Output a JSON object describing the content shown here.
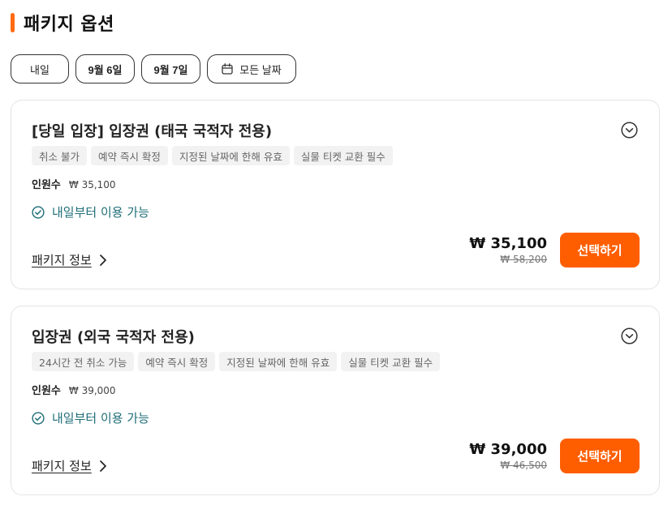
{
  "section": {
    "title": "패키지 옵션",
    "accent_color": "#ff6a13"
  },
  "dates": [
    {
      "label": "내일"
    },
    {
      "label": "9월 6일"
    },
    {
      "label": "9월 7일"
    },
    {
      "label": "모든 날짜",
      "icon": "calendar-icon"
    }
  ],
  "packages": [
    {
      "title": "[당일 입장] 입장권 (태국 국적자 전용)",
      "tags": [
        "취소 불가",
        "예약 즉시 확정",
        "지정된 날짜에 한해 유효",
        "실물 티켓 교환 필수"
      ],
      "pax_label": "인원수",
      "pax_price": "₩ 35,100",
      "availability": "내일부터 이용 가능",
      "info_link": "패키지 정보",
      "price": "₩ 35,100",
      "original_price": "₩ 58,200",
      "select_label": "선택하기"
    },
    {
      "title": "입장권 (외국 국적자 전용)",
      "tags": [
        "24시간 전 취소 가능",
        "예약 즉시 확정",
        "지정된 날짜에 한해 유효",
        "실물 티켓 교환 필수"
      ],
      "pax_label": "인원수",
      "pax_price": "₩ 39,000",
      "availability": "내일부터 이용 가능",
      "info_link": "패키지 정보",
      "price": "₩ 39,000",
      "original_price": "₩ 46,500",
      "select_label": "선택하기"
    }
  ],
  "colors": {
    "button": "#ff5e00",
    "availability": "#1f6e78"
  }
}
